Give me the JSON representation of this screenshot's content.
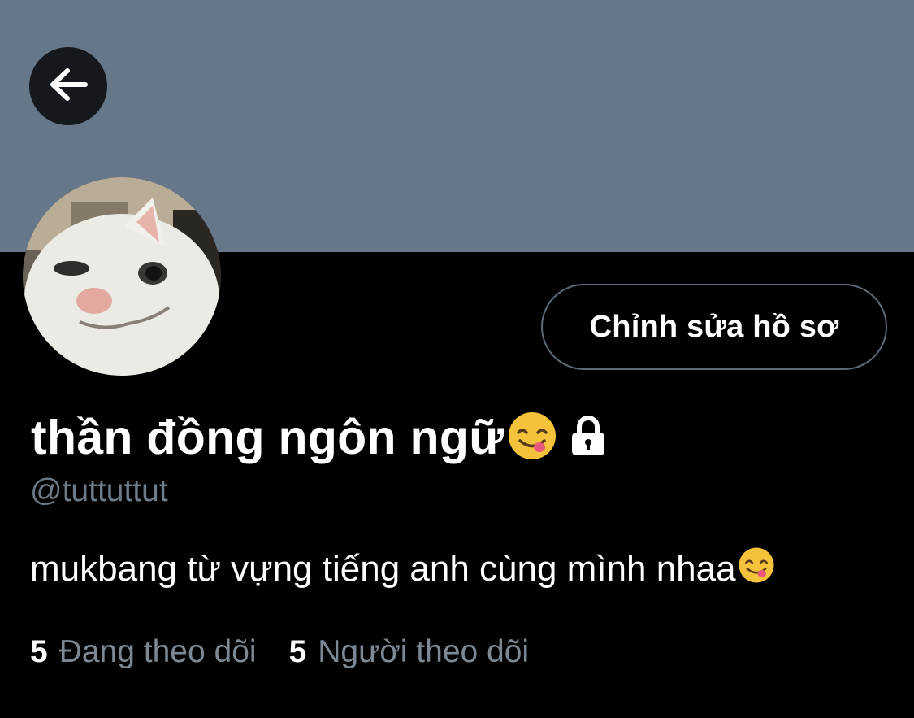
{
  "profile": {
    "display_name": "thần đồng ngôn ngữ",
    "name_emoji": "yum-emoji",
    "protected_icon": "lock-icon",
    "handle": "@tuttuttut",
    "bio": "mukbang từ vựng tiếng anh cùng mình nhaa",
    "bio_emoji": "yum-emoji"
  },
  "header": {
    "back_icon": "arrow-left-icon",
    "banner_color": "#67778a"
  },
  "actions": {
    "edit_profile_label": "Chỉnh sửa hồ sơ"
  },
  "stats": {
    "following_count": "5",
    "following_label": "Đang theo dõi",
    "followers_count": "5",
    "followers_label": "Người theo dõi"
  },
  "colors": {
    "background": "#000000",
    "text_primary": "#ffffff",
    "text_secondary": "#6e7b88",
    "button_border": "#5e6a76"
  }
}
